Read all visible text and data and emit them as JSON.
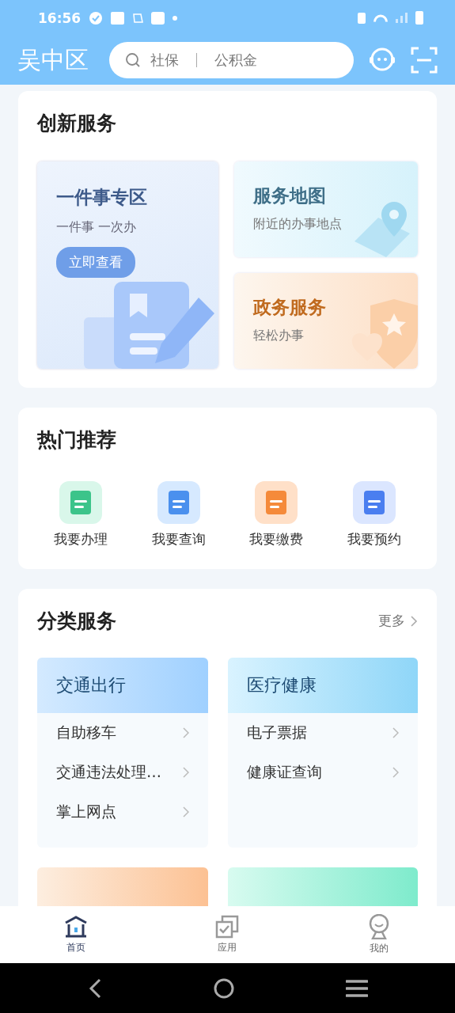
{
  "status_bar": {
    "time": "16:56"
  },
  "header": {
    "title": "吴中区",
    "search": {
      "hints": [
        "社保",
        "公积金"
      ]
    }
  },
  "innovation": {
    "title": "创新服务",
    "main_card": {
      "title": "一件事专区",
      "subtitle": "一件事 一次办",
      "button": "立即查看"
    },
    "side_cards": [
      {
        "kind": "map",
        "title": "服务地图",
        "subtitle": "附近的办事地点"
      },
      {
        "kind": "gov",
        "title": "政务服务",
        "subtitle": "轻松办事"
      }
    ]
  },
  "hot": {
    "title": "热门推荐",
    "items": [
      {
        "kind": "handle",
        "label": "我要办理"
      },
      {
        "kind": "query",
        "label": "我要查询"
      },
      {
        "kind": "pay",
        "label": "我要缴费"
      },
      {
        "kind": "book",
        "label": "我要预约"
      }
    ]
  },
  "category": {
    "title": "分类服务",
    "more": "更多",
    "groups": [
      {
        "kind": "blue",
        "title": "交通出行",
        "items": [
          "自助移车",
          "交通违法处理…",
          "掌上网点"
        ]
      },
      {
        "kind": "cyan",
        "title": "医疗健康",
        "items": [
          "电子票据",
          "健康证查询"
        ]
      }
    ],
    "cut_groups": [
      {
        "kind": "orange"
      },
      {
        "kind": "green"
      }
    ]
  },
  "tab_bar": [
    {
      "kind": "home",
      "label": "首页",
      "selected": true
    },
    {
      "kind": "apps",
      "label": "应用",
      "selected": false
    },
    {
      "kind": "me",
      "label": "我的",
      "selected": false
    }
  ]
}
